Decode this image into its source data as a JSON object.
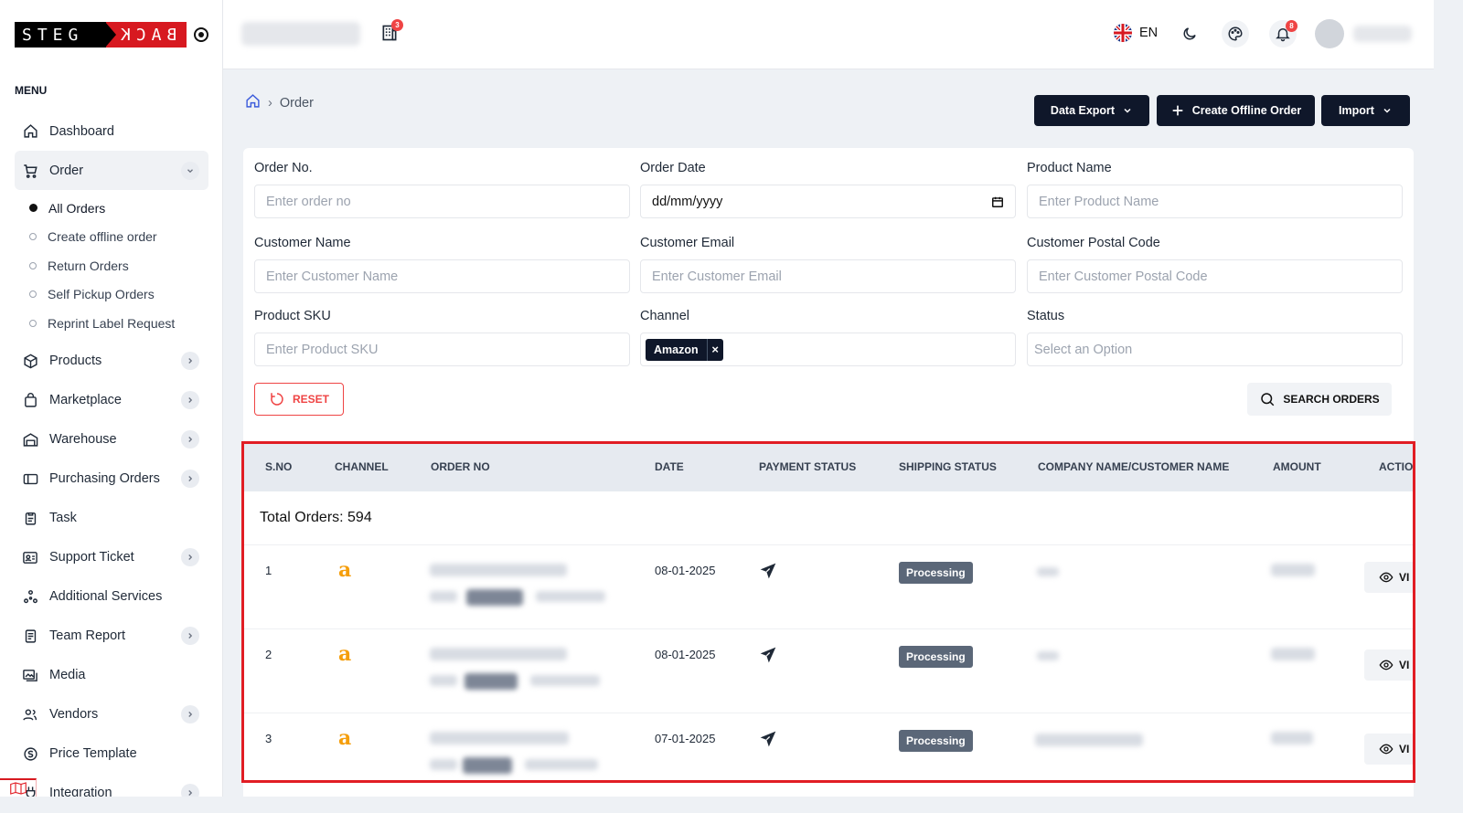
{
  "brand": {
    "logo_left": "STEG",
    "logo_right": "BACK"
  },
  "sidebar": {
    "menu_title": "MENU",
    "items": [
      {
        "label": "Dashboard",
        "icon": "home-icon",
        "chevron": false
      },
      {
        "label": "Order",
        "icon": "cart-icon",
        "chevron": true,
        "expanded": true
      },
      {
        "label": "Products",
        "icon": "box-icon",
        "chevron": true
      },
      {
        "label": "Marketplace",
        "icon": "bag-icon",
        "chevron": true
      },
      {
        "label": "Warehouse",
        "icon": "warehouse-icon",
        "chevron": true
      },
      {
        "label": "Purchasing Orders",
        "icon": "card-icon",
        "chevron": true
      },
      {
        "label": "Task",
        "icon": "clipboard-icon",
        "chevron": false
      },
      {
        "label": "Support Ticket",
        "icon": "contact-card-icon",
        "chevron": true
      },
      {
        "label": "Additional Services",
        "icon": "network-icon",
        "chevron": false
      },
      {
        "label": "Team Report",
        "icon": "report-icon",
        "chevron": true
      },
      {
        "label": "Media",
        "icon": "media-icon",
        "chevron": false
      },
      {
        "label": "Vendors",
        "icon": "users-icon",
        "chevron": true
      },
      {
        "label": "Price Template",
        "icon": "currency-icon",
        "chevron": false
      },
      {
        "label": "Integration",
        "icon": "plug-icon",
        "chevron": true
      }
    ],
    "order_sub": [
      "All Orders",
      "Create offline order",
      "Return Orders",
      "Self Pickup Orders",
      "Reprint Label Request"
    ]
  },
  "topbar": {
    "building_badge": "3",
    "language": "EN",
    "notification_badge": "8"
  },
  "breadcrumb": {
    "current": "Order"
  },
  "actions": {
    "export": "Data Export",
    "create": "Create Offline Order",
    "import": "Import"
  },
  "filters": {
    "order_no": {
      "label": "Order No.",
      "placeholder": "Enter order no"
    },
    "order_date": {
      "label": "Order Date",
      "value": "dd/mm/yyyy"
    },
    "product_name": {
      "label": "Product Name",
      "placeholder": "Enter Product Name"
    },
    "customer_name": {
      "label": "Customer Name",
      "placeholder": "Enter Customer Name"
    },
    "customer_email": {
      "label": "Customer Email",
      "placeholder": "Enter Customer Email"
    },
    "customer_postal": {
      "label": "Customer Postal Code",
      "placeholder": "Enter Customer Postal Code"
    },
    "product_sku": {
      "label": "Product SKU",
      "placeholder": "Enter Product SKU"
    },
    "channel": {
      "label": "Channel",
      "chip": "Amazon"
    },
    "status": {
      "label": "Status",
      "placeholder": "Select an Option"
    },
    "reset": "RESET",
    "search": "SEARCH ORDERS"
  },
  "table": {
    "headers": [
      "S.NO",
      "CHANNEL",
      "ORDER NO",
      "DATE",
      "PAYMENT STATUS",
      "SHIPPING STATUS",
      "COMPANY NAME/CUSTOMER NAME",
      "AMOUNT",
      "ACTIO"
    ],
    "total_label": "Total Orders: 594",
    "rows": [
      {
        "sno": "1",
        "channel": "a",
        "date": "08-01-2025",
        "shipping": "Processing",
        "action": "VI"
      },
      {
        "sno": "2",
        "channel": "a",
        "date": "08-01-2025",
        "shipping": "Processing",
        "action": "VI"
      },
      {
        "sno": "3",
        "channel": "a",
        "date": "07-01-2025",
        "shipping": "Processing",
        "action": "VI"
      }
    ]
  },
  "colors": {
    "accent": "#0f172a",
    "danger": "#ef4444",
    "badge": "#5b6778",
    "highlight": "#e11d24"
  }
}
